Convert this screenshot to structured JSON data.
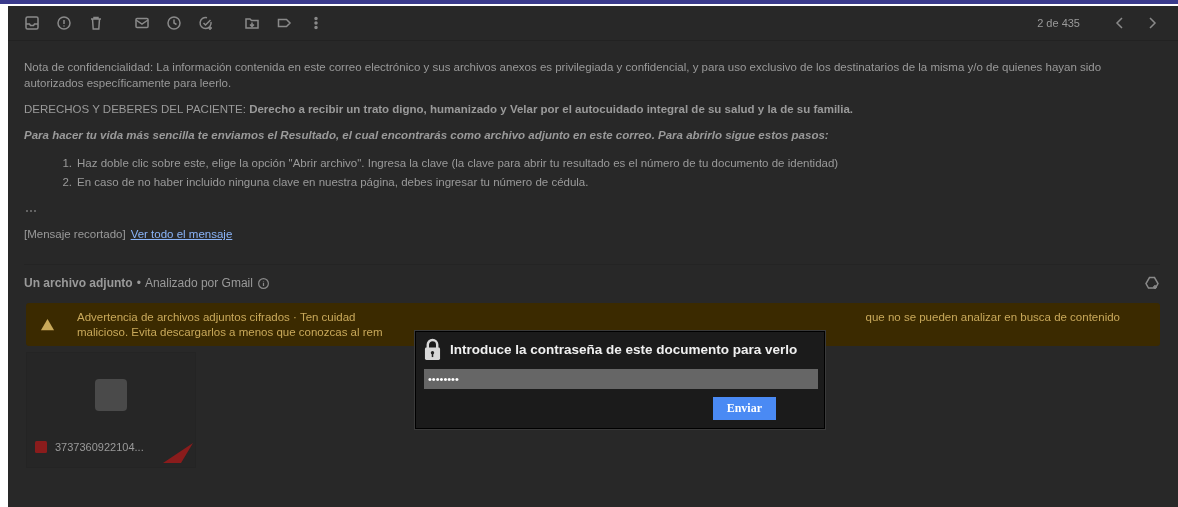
{
  "toolbar": {
    "pager": "2 de 435"
  },
  "message": {
    "notice": "Nota de confidencialidad: La información contenida en este correo electrónico y sus archivos anexos es privilegiada y confidencial, y para uso exclusivo de los destinatarios de la misma y/o de quienes hayan sido autorizados específicamente para leerlo.",
    "rights": "DERECHOS Y DEBERES DEL PACIENTE: **Derecho a recibir un trato digno, humanizado y Velar por el autocuidado integral de su salud y la de su familia.**",
    "intro": "Para hacer tu vida más sencilla te enviamos el Resultado, el cual encontrarás como archivo adjunto en este correo. Para abrirlo sigue estos pasos:",
    "steps": [
      {
        "number": "1.",
        "text": "Haz doble clic sobre este, elige la opción \"Abrir archivo\". Ingresa la clave (la clave para abrir tu resultado es el número de tu documento de identidad)"
      },
      {
        "number": "2.",
        "text": "En caso de no haber incluido ninguna clave en nuestra página, debes ingresar tu número de cédula."
      }
    ],
    "clipped": "[Mensaje recortado]",
    "view_all_link": "Ver todo el mensaje"
  },
  "attachments": {
    "heading": "Un archivo adjunto",
    "separator": "•",
    "scanned": "Analizado por Gmail",
    "warning": {
      "line1_left": "Advertencia de archivos adjuntos cifrados · Ten cuidad",
      "line1_right": "que no se pueden analizar en busca de contenido",
      "line2_left": "malicioso. Evita descargarlos a menos que conozcas al rem"
    },
    "file": {
      "name": "3737360922104..."
    }
  },
  "dialog": {
    "title": "Introduce la contraseña de este documento para verlo",
    "password": "••••••••",
    "submit": "Enviar"
  }
}
